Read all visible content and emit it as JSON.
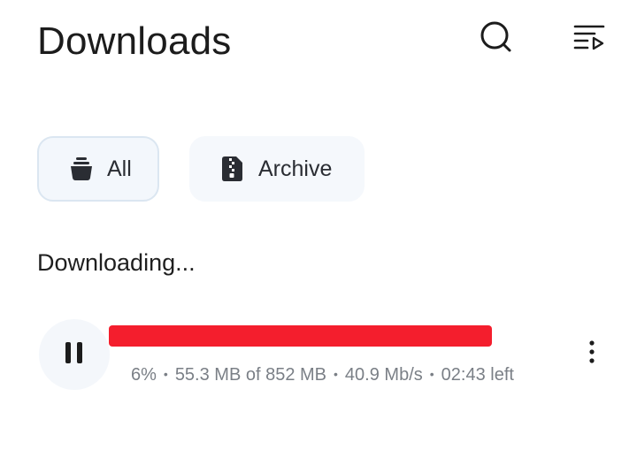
{
  "header": {
    "title": "Downloads",
    "search_icon": "search-icon",
    "playlist_icon": "playlist-play-icon"
  },
  "filters": [
    {
      "label": "All",
      "icon": "basket-icon",
      "selected": true
    },
    {
      "label": "Archive",
      "icon": "zip-file-icon",
      "selected": false
    }
  ],
  "section": {
    "title": "Downloading..."
  },
  "download": {
    "name": "",
    "progress_percent": "6%",
    "downloaded": "55.3 MB of 852 MB",
    "speed": "40.9 Mb/s",
    "time_left": "02:43 left",
    "separator": "•",
    "pause_icon": "pause-icon",
    "more_icon": "more-vertical-icon"
  },
  "colors": {
    "redaction": "#f41e2d",
    "chip_selected_bg": "#f3f7fc",
    "chip_selected_border": "#dbe6f1",
    "meta_text": "#7a7f86"
  }
}
